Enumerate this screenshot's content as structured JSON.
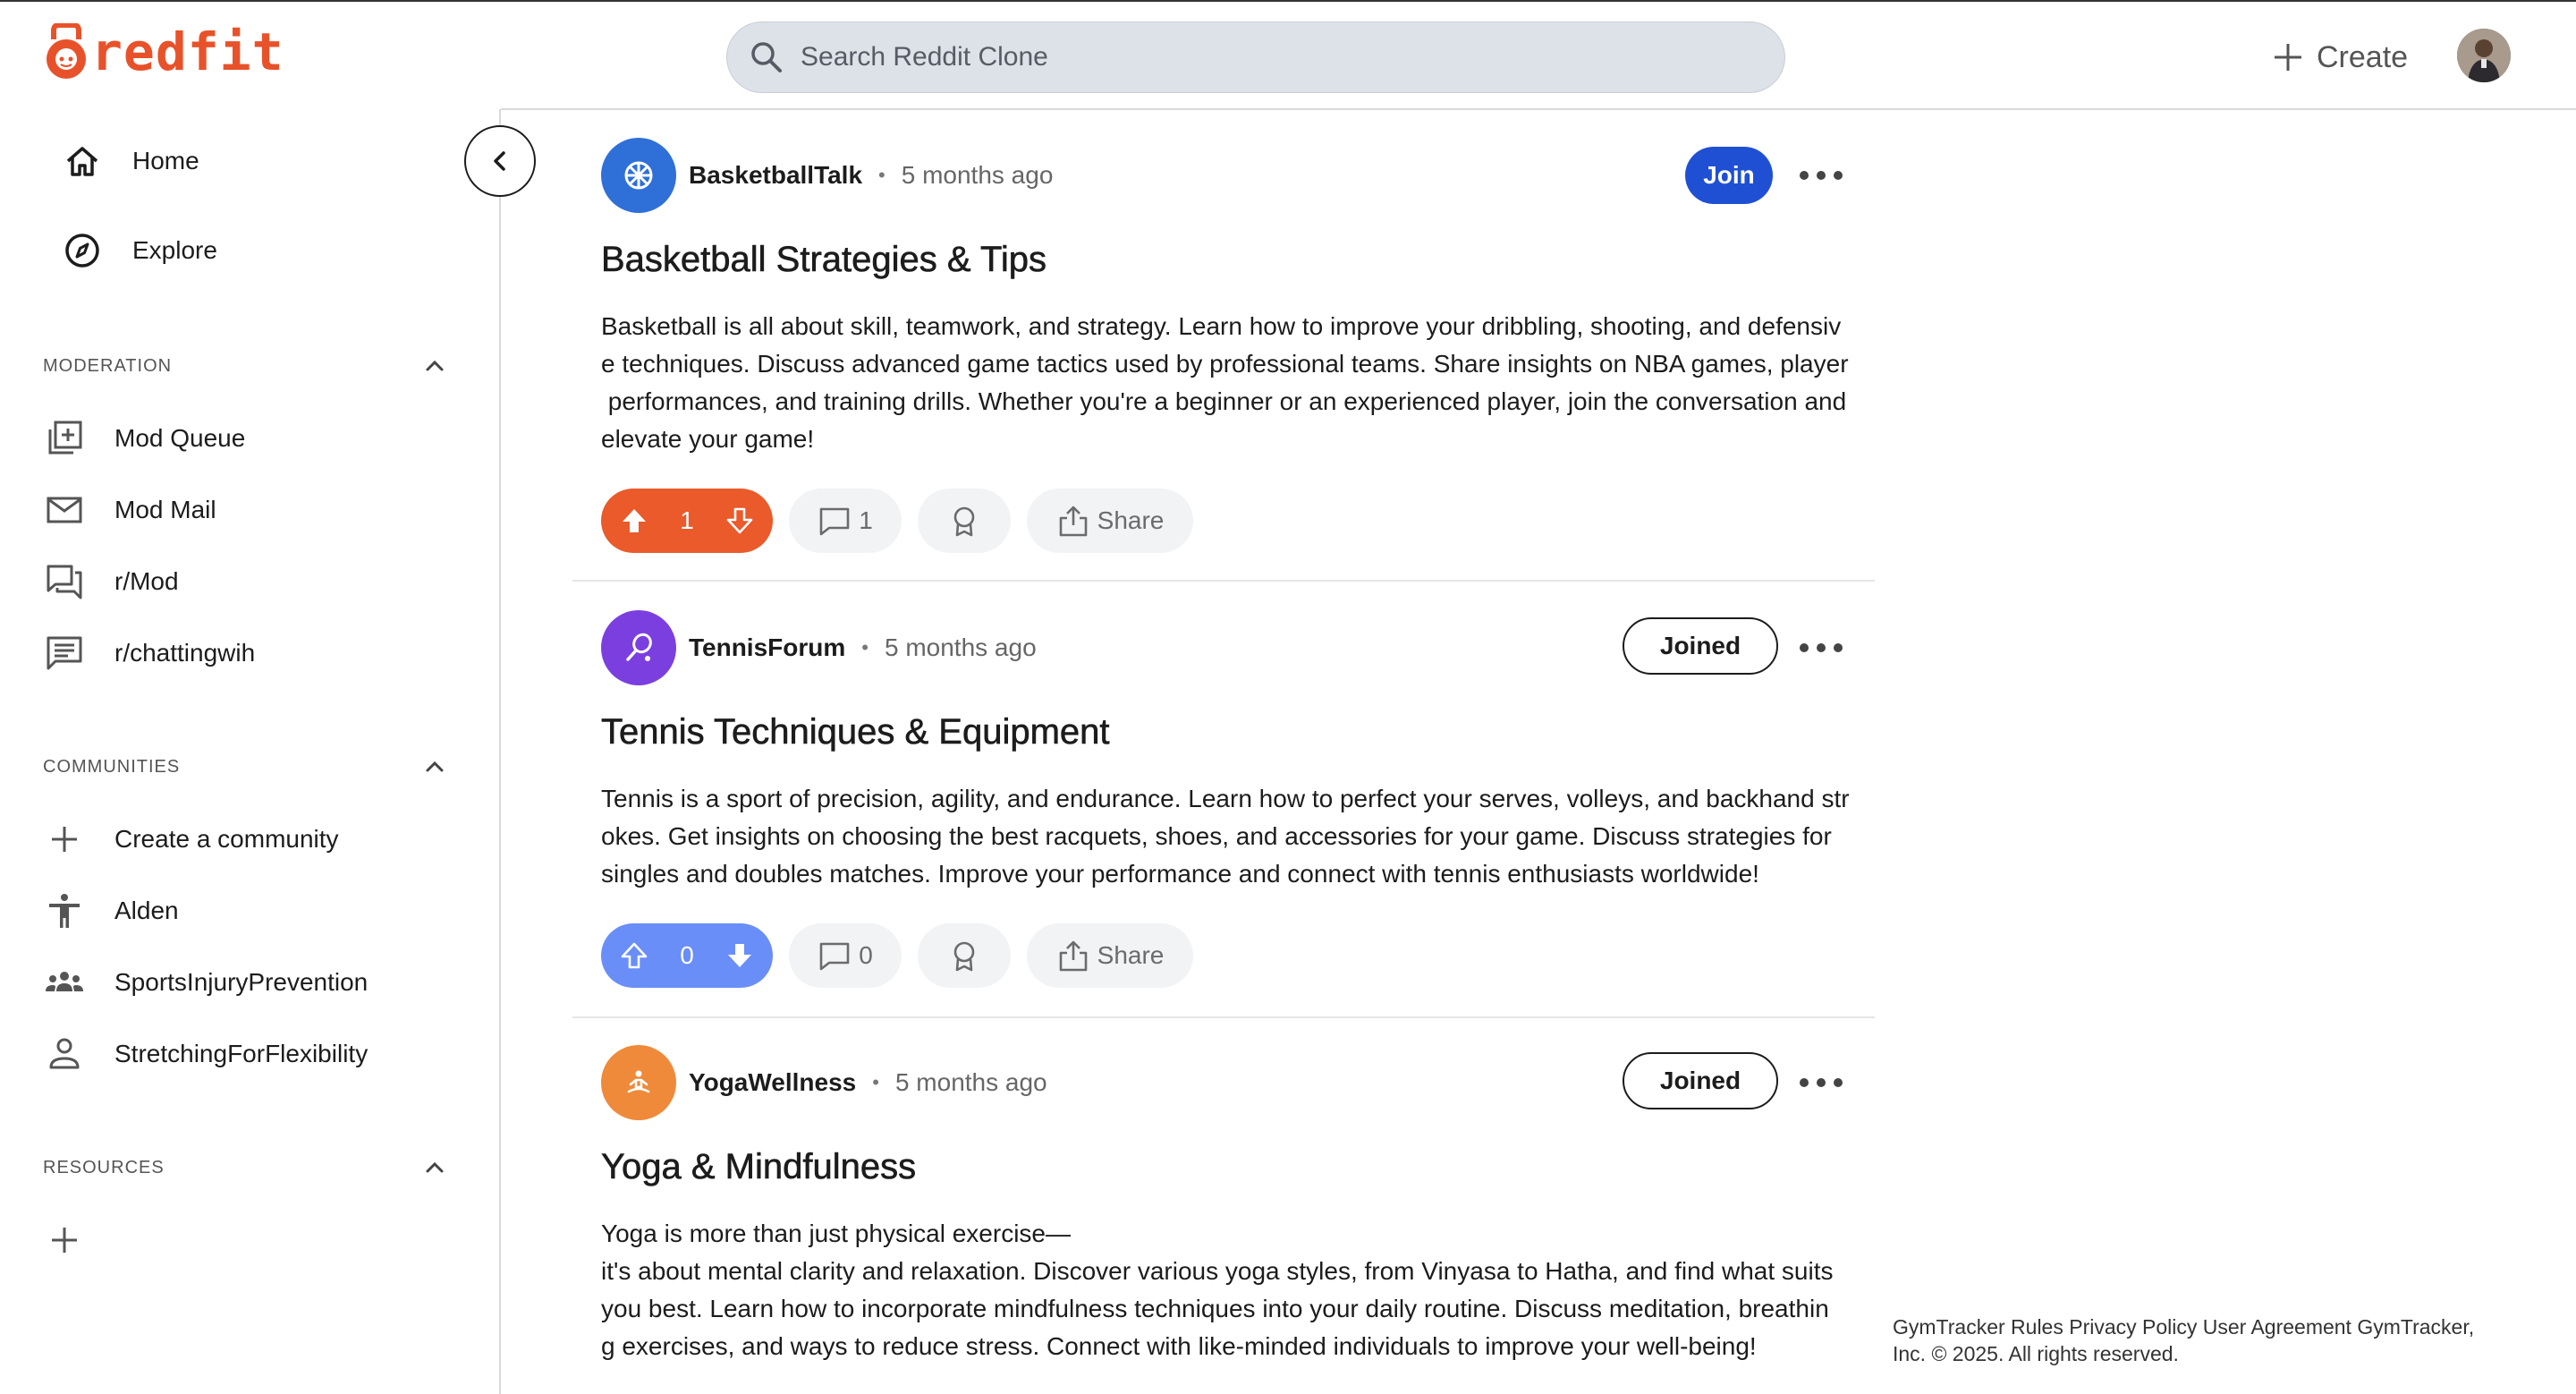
{
  "header": {
    "logo_text": "redfit",
    "search_placeholder": "Search Reddit Clone",
    "create_label": "Create",
    "brand_color": "#e8522a"
  },
  "sidebar": {
    "nav": [
      {
        "label": "Home",
        "icon": "home-icon"
      },
      {
        "label": "Explore",
        "icon": "compass-icon"
      }
    ],
    "moderation": {
      "title": "MODERATION",
      "items": [
        {
          "label": "Mod Queue",
          "icon": "mod-queue-icon"
        },
        {
          "label": "Mod Mail",
          "icon": "mail-icon"
        },
        {
          "label": "r/Mod",
          "icon": "forum-icon"
        },
        {
          "label": "r/chattingwih",
          "icon": "chat-icon"
        }
      ]
    },
    "communities": {
      "title": "COMMUNITIES",
      "items": [
        {
          "label": "Create a community",
          "icon": "plus-icon"
        },
        {
          "label": "Alden",
          "icon": "person-arms-icon"
        },
        {
          "label": "SportsInjuryPrevention",
          "icon": "group-icon"
        },
        {
          "label": "StretchingForFlexibility",
          "icon": "person-outline-icon"
        }
      ]
    },
    "resources": {
      "title": "RESOURCES"
    }
  },
  "posts": [
    {
      "subreddit": "BasketballTalk",
      "time": "5 months ago",
      "join_label": "Join",
      "title": "Basketball Strategies & Tips",
      "body": "Basketball is all about skill, teamwork, and strategy. Learn how to improve your dribbling, shooting, and defensiv\ne techniques. Discuss advanced game tactics used by professional teams. Share insights on NBA games, player\n performances, and training drills. Whether you're a beginner or an experienced player, join the conversation and\nelevate your game!",
      "votes": "1",
      "comments": "1",
      "share_label": "Share",
      "icon_color": "#2f6fd8"
    },
    {
      "subreddit": "TennisForum",
      "time": "5 months ago",
      "join_label": "Joined",
      "title": "Tennis Techniques & Equipment",
      "body": "Tennis is a sport of precision, agility, and endurance. Learn how to perfect your serves, volleys, and backhand str\nokes. Get insights on choosing the best racquets, shoes, and accessories for your game. Discuss strategies for\nsingles and doubles matches. Improve your performance and connect with tennis enthusiasts worldwide!",
      "votes": "0",
      "comments": "0",
      "share_label": "Share",
      "icon_color": "#7b3fe0"
    },
    {
      "subreddit": "YogaWellness",
      "time": "5 months ago",
      "join_label": "Joined",
      "title": "Yoga & Mindfulness",
      "body": "Yoga is more than just physical exercise—\nit's about mental clarity and relaxation. Discover various yoga styles, from Vinyasa to Hatha, and find what suits\nyou best. Learn how to incorporate mindfulness techniques into your daily routine. Discuss meditation, breathin\ng exercises, and ways to reduce stress. Connect with like-minded individuals to improve your well-being!",
      "icon_color": "#ee8a3a"
    }
  ],
  "footer": {
    "text": "GymTracker Rules Privacy Policy User Agreement GymTracker, Inc. © 2025. All rights reserved."
  }
}
